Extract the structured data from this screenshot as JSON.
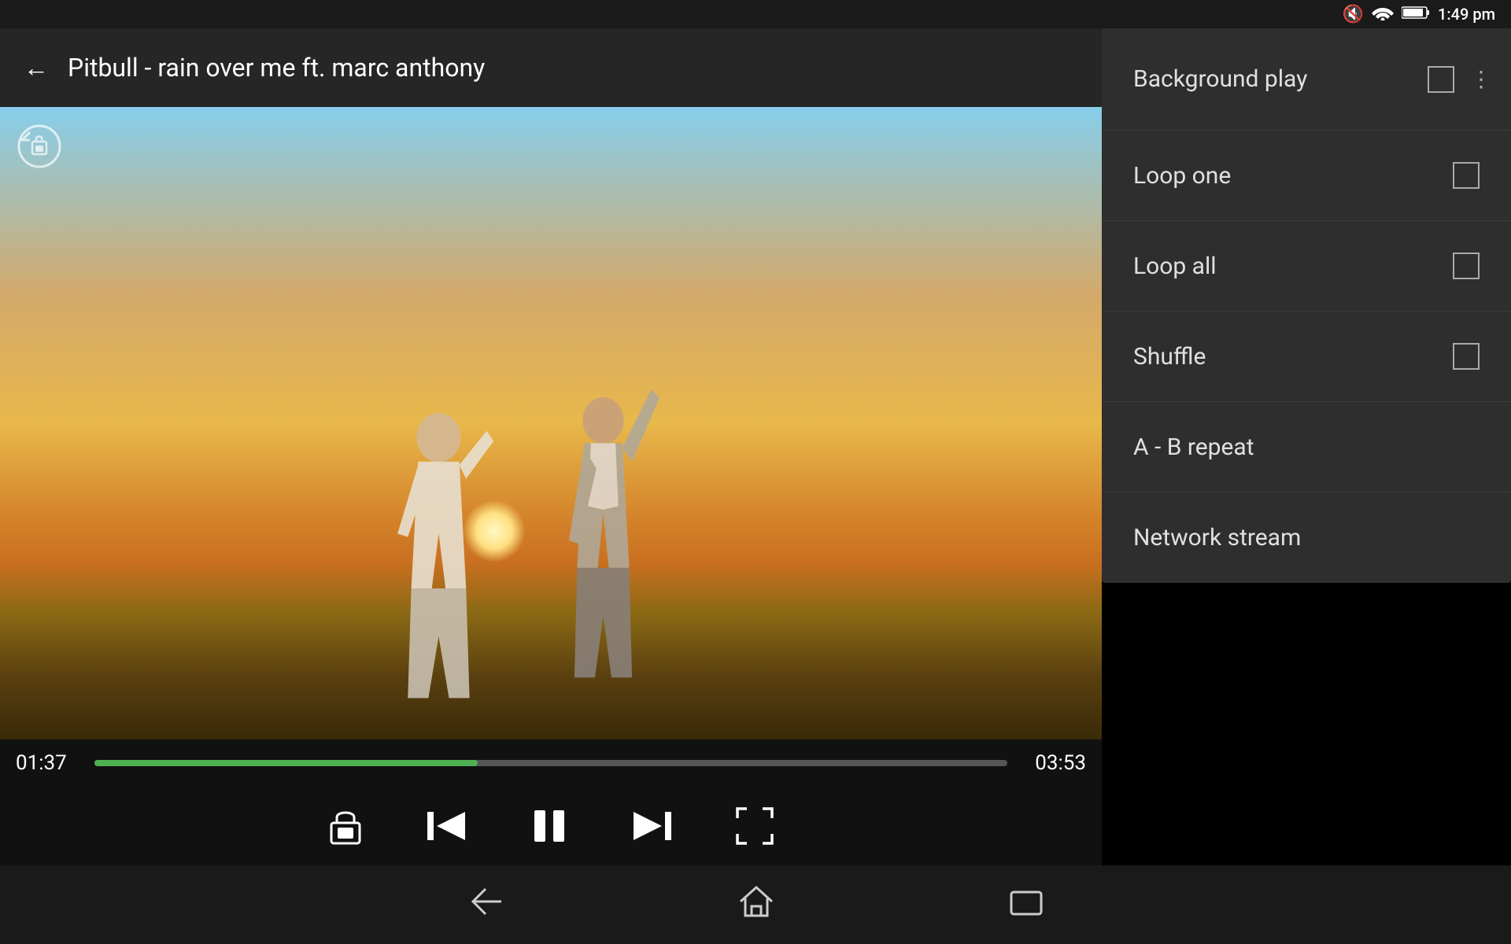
{
  "statusBar": {
    "time": "1:49 pm",
    "icons": [
      "mute",
      "wifi",
      "battery"
    ]
  },
  "appBar": {
    "backIcon": "←",
    "title": "Pitbull - rain over me ft. marc anthony"
  },
  "video": {
    "rotationIcon": "⟳"
  },
  "progress": {
    "current": "01:37",
    "total": "03:53",
    "percent": 42
  },
  "controls": {
    "lock": "🔒",
    "prev": "⏮",
    "pause": "⏸",
    "next": "⏭",
    "fullscreen": "⛶"
  },
  "dropdown": {
    "items": [
      {
        "id": "background-play",
        "label": "Background play",
        "hasCheckbox": true,
        "checked": false,
        "hasMore": true
      },
      {
        "id": "loop-one",
        "label": "Loop one",
        "hasCheckbox": true,
        "checked": false,
        "hasMore": false
      },
      {
        "id": "loop-all",
        "label": "Loop all",
        "hasCheckbox": true,
        "checked": false,
        "hasMore": false
      },
      {
        "id": "shuffle",
        "label": "Shuffle",
        "hasCheckbox": true,
        "checked": false,
        "hasMore": false
      },
      {
        "id": "ab-repeat",
        "label": "A - B repeat",
        "hasCheckbox": false,
        "checked": false,
        "hasMore": false
      },
      {
        "id": "network-stream",
        "label": "Network stream",
        "hasCheckbox": false,
        "checked": false,
        "hasMore": false
      }
    ]
  },
  "navBar": {
    "back": "←",
    "home": "⌂",
    "recents": "▭"
  }
}
